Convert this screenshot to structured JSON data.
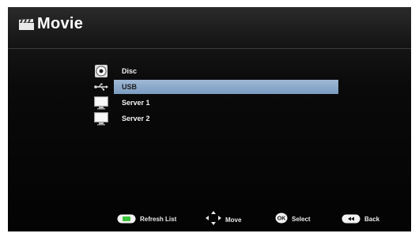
{
  "header": {
    "title": "Movie"
  },
  "sources": [
    {
      "label": "Disc",
      "icon": "disc-icon"
    },
    {
      "label": "USB",
      "icon": "usb-icon",
      "selected": true
    },
    {
      "label": "Server 1",
      "icon": "server-icon"
    },
    {
      "label": "Server 2",
      "icon": "server-icon"
    }
  ],
  "footer": {
    "refresh": {
      "label": "Refresh List",
      "icon": "green-button-icon"
    },
    "move": {
      "label": "Move",
      "icon": "dpad-arrows-icon"
    },
    "select": {
      "label": "Select",
      "icon": "ok-button-icon"
    },
    "back": {
      "label": "Back",
      "icon": "back-button-icon"
    }
  },
  "colors": {
    "selection": "#8fadcf",
    "green_key": "#3cc23c"
  }
}
